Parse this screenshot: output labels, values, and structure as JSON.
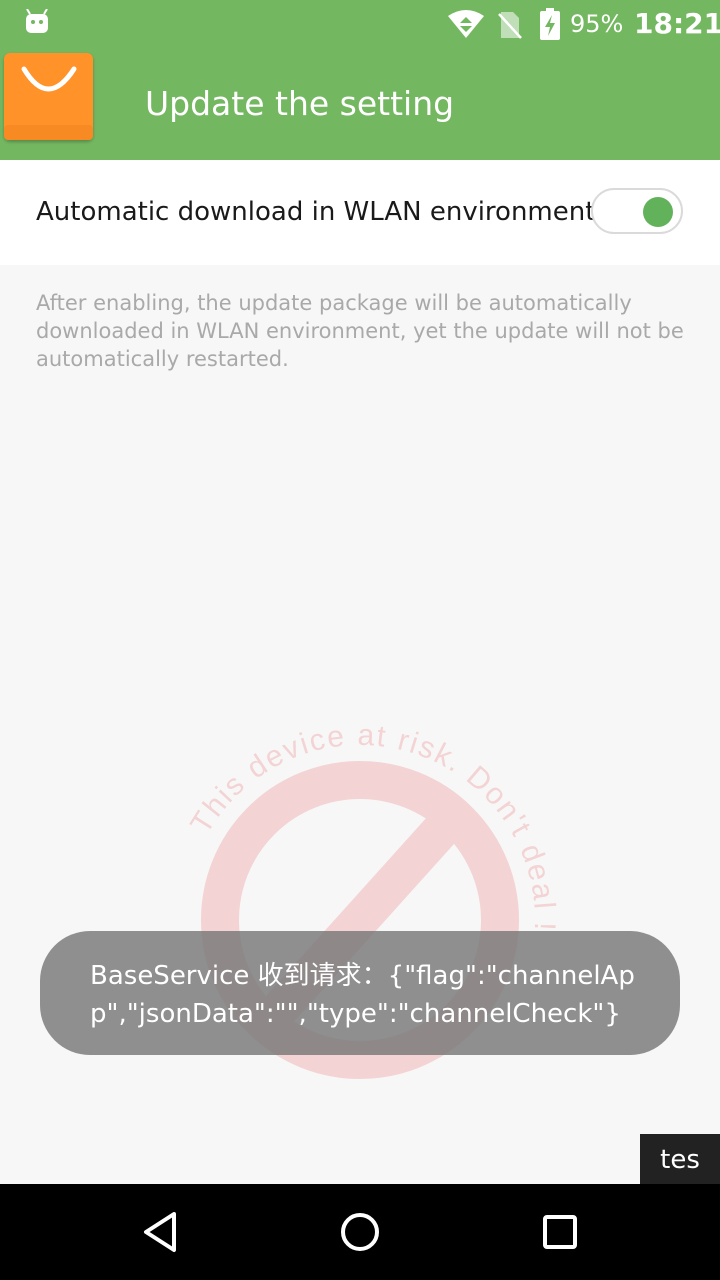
{
  "status_bar": {
    "battery_percent": "95%",
    "time": "18:21",
    "icons": [
      "android-debug-icon",
      "wifi-icon",
      "no-sim-icon",
      "battery-charging-icon"
    ]
  },
  "app_bar": {
    "title": "Update the setting",
    "icon": "shopping-bag-icon",
    "accent_color": "#74b761"
  },
  "setting": {
    "label": "Automatic download in WLAN environment",
    "toggle_on": true,
    "toggle_color": "#62b25b"
  },
  "description": "After enabling, the update package will be automatically downloaded in WLAN environment, yet the update will not be automatically restarted.",
  "watermark": {
    "text": "This device at risk. Don't deal !",
    "icon": "prohibited-icon"
  },
  "toast": {
    "message": "BaseService 收到请求：{\"flag\":\"channelApp\",\"jsonData\":\"\",\"type\":\"channelCheck\"}"
  },
  "corner_label": "tes",
  "nav_bar": {
    "icons": [
      "back-icon",
      "home-icon",
      "recents-icon"
    ]
  }
}
